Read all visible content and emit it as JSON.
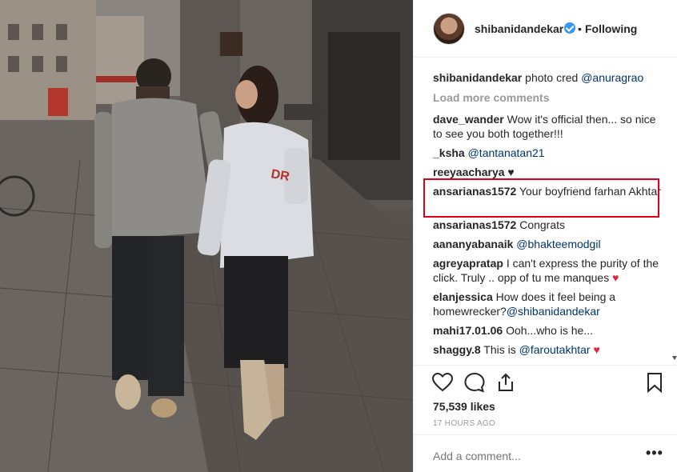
{
  "post": {
    "username": "shibanidandekar",
    "follow_status": "Following",
    "separator": "•"
  },
  "comments": [
    {
      "user": "shibanidandekar",
      "text": "photo cred ",
      "mention": "@anuragrao"
    },
    {
      "load_more": "Load more comments"
    },
    {
      "user": "dave_wander",
      "text": "Wow it's official then... so nice to see you both together!!!"
    },
    {
      "user": "_ksha",
      "text": "",
      "mention": "@tantanatan21"
    },
    {
      "user": "reeyaacharya",
      "text": "♥"
    },
    {
      "user": "ansarianas1572",
      "text": "Your boyfriend farhan Akhtar"
    },
    {
      "user": "ansarianas1572",
      "text": "Congrats"
    },
    {
      "user": "aananyabanaik",
      "text": "",
      "mention": "@bhakteemodgil"
    },
    {
      "user": "agreyapratap",
      "text": "I can't express the purity of the click. Truly .. opp of tu me manques",
      "emoji": "♥"
    },
    {
      "user": "elanjessica",
      "text": "How does it feel being a homewrecker?",
      "mention": "@shibanidandekar"
    },
    {
      "user": "mahi17.01.06",
      "text": "Ooh...who is he..."
    },
    {
      "user": "shaggy.8",
      "text": "This is ",
      "mention": "@faroutakhtar",
      "emoji": "♥"
    }
  ],
  "likes": "75,539 likes",
  "timestamp": "17 HOURS AGO",
  "add_comment_placeholder": "Add a comment...",
  "more_label": "•••",
  "icons": {
    "like": "heart-icon",
    "comment": "comment-icon",
    "share": "share-icon",
    "save": "bookmark-icon",
    "verified": "verified-badge-icon"
  },
  "colors": {
    "verified": "#3897f0",
    "mention": "#003569",
    "highlight": "#e0001b",
    "heart": "#e0243a"
  }
}
